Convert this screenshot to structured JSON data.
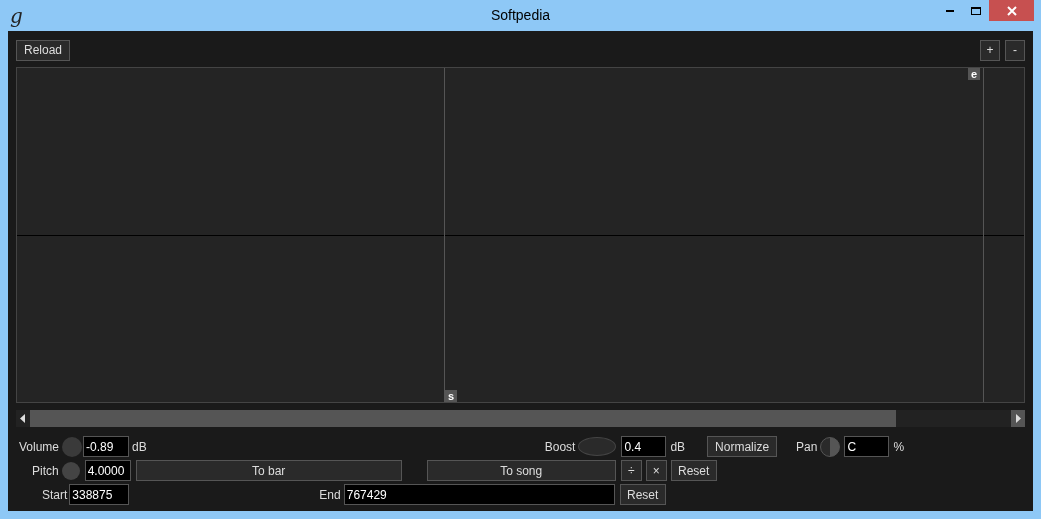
{
  "window": {
    "title": "Softpedia",
    "icon": "g"
  },
  "toolbar": {
    "reload": "Reload",
    "zoom_in": "+",
    "zoom_out": "-"
  },
  "waveform": {
    "start_marker": "s",
    "end_marker": "e"
  },
  "volume": {
    "label": "Volume",
    "value": "-0.89",
    "unit": "dB"
  },
  "boost": {
    "label": "Boost",
    "value": "0.4",
    "unit": "dB"
  },
  "normalize": "Normalize",
  "pan": {
    "label": "Pan",
    "value": "C",
    "unit": "%"
  },
  "pitch": {
    "label": "Pitch",
    "value": "4.0000"
  },
  "pitch_buttons": [
    "To bar",
    "To song",
    "÷",
    "×",
    "Reset"
  ],
  "start": {
    "label": "Start",
    "value": "338875"
  },
  "end": {
    "label": "End",
    "value": "767429"
  },
  "range_reset": "Reset"
}
